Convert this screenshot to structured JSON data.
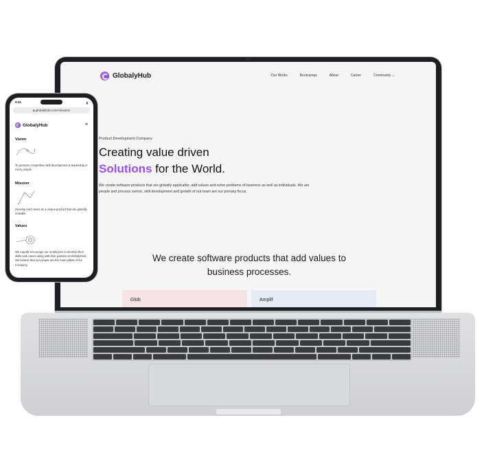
{
  "laptop": {
    "brand": "GlobalyHub",
    "nav": [
      "Our Works",
      "Bootcamps",
      "About",
      "Career",
      "Community"
    ],
    "kicker": "Product Development Company",
    "headline_line1": "Creating value driven",
    "headline_accent": "Solutions",
    "headline_rest": " for the World.",
    "description": "We create software products that are globally applicable, add values and solve problems of business as well as individuals. We are people and process centric, skill development and growth of our team are our primary focus.",
    "section_heading": "We create software products that add values to business processes.",
    "card1_title": "Glob",
    "card2_title": "Amplif"
  },
  "phone": {
    "time": "9:41",
    "battery": "▮",
    "url": "globalyhub.com/AboutUs",
    "brand": "GlobalyHub",
    "vision_title": "Vision",
    "vision_text": "To promote competitive skill development & leadership in every people.",
    "mission_title": "Mission",
    "mission_text": "Develop each team as a unique product that are globally scalable.",
    "values_title": "Values",
    "values_text": "We equally encourage our employees to develop their skills and career along with their position at GlobalyHub. We believe that our people are the main pillars of the Company."
  },
  "colors": {
    "accent": "#9b4ef0",
    "card1": "#f5e3e5",
    "card2": "#e5ecf4"
  }
}
